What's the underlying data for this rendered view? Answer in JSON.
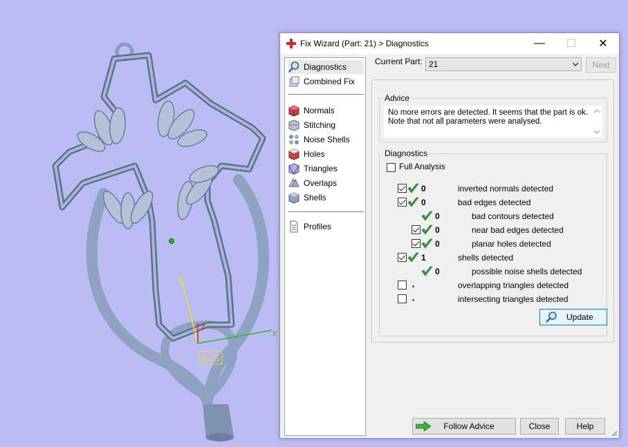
{
  "scene": {
    "axis_labels": {
      "x": "x",
      "y": "y",
      "z": "z"
    },
    "wcs_label": "WCS",
    "colors": {
      "background": "#bcbcf5",
      "model": "#9fb1cc",
      "x_axis": "#22bb22",
      "y_axis": "#e8e820",
      "z_axis": "#dd2222"
    }
  },
  "window": {
    "title": "Fix Wizard (Part: 21) > Diagnostics",
    "app_icon": "red-cross-icon",
    "controls": {
      "minimize": "—",
      "maximize": "☐",
      "close": "✕"
    }
  },
  "sidebar": {
    "items": [
      {
        "label": "Diagnostics",
        "icon": "magnifier-icon",
        "selected": true
      },
      {
        "label": "Combined Fix",
        "icon": "cube-stack-icon"
      },
      {
        "label": "Normals",
        "icon": "normals-cube-icon"
      },
      {
        "label": "Stitching",
        "icon": "stitching-icon"
      },
      {
        "label": "Noise Shells",
        "icon": "noise-shells-icon"
      },
      {
        "label": "Holes",
        "icon": "holes-cube-icon"
      },
      {
        "label": "Triangles",
        "icon": "triangles-icon"
      },
      {
        "label": "Overlaps",
        "icon": "overlaps-icon"
      },
      {
        "label": "Shells",
        "icon": "shells-icon"
      },
      {
        "label": "Profiles",
        "icon": "document-icon"
      }
    ]
  },
  "current_part": {
    "label": "Current Part:",
    "value": "21",
    "next_label": "Next"
  },
  "advice": {
    "title": "Advice",
    "text": "No more errors are detected. It seems that the part is ok. Note that not all parameters were analysed."
  },
  "diagnostics": {
    "title": "Diagnostics",
    "full_analysis_label": "Full Analysis",
    "full_analysis_checked": false,
    "rows": [
      {
        "checkbox": true,
        "checked": true,
        "status": "ok",
        "count": "0",
        "label": "inverted normals detected"
      },
      {
        "checkbox": true,
        "checked": true,
        "status": "ok",
        "count": "0",
        "label": "bad edges detected"
      },
      {
        "checkbox": false,
        "checked": false,
        "status": "ok",
        "count": "0",
        "label": "bad contours detected"
      },
      {
        "checkbox": true,
        "checked": true,
        "status": "ok",
        "count": "0",
        "label": "near bad edges detected"
      },
      {
        "checkbox": true,
        "checked": true,
        "status": "ok",
        "count": "0",
        "label": "planar holes detected"
      },
      {
        "checkbox": true,
        "checked": true,
        "status": "ok",
        "count": "1",
        "label": "shells detected"
      },
      {
        "checkbox": false,
        "checked": false,
        "status": "ok",
        "count": "0",
        "label": "possible noise shells detected"
      },
      {
        "checkbox": true,
        "checked": false,
        "status": "pending",
        "count": "",
        "label": "overlapping triangles detected"
      },
      {
        "checkbox": true,
        "checked": false,
        "status": "pending",
        "count": "",
        "label": "intersecting triangles detected"
      }
    ],
    "update_label": "Update"
  },
  "footer": {
    "follow_advice_label": "Follow Advice",
    "close_label": "Close",
    "help_label": "Help"
  }
}
